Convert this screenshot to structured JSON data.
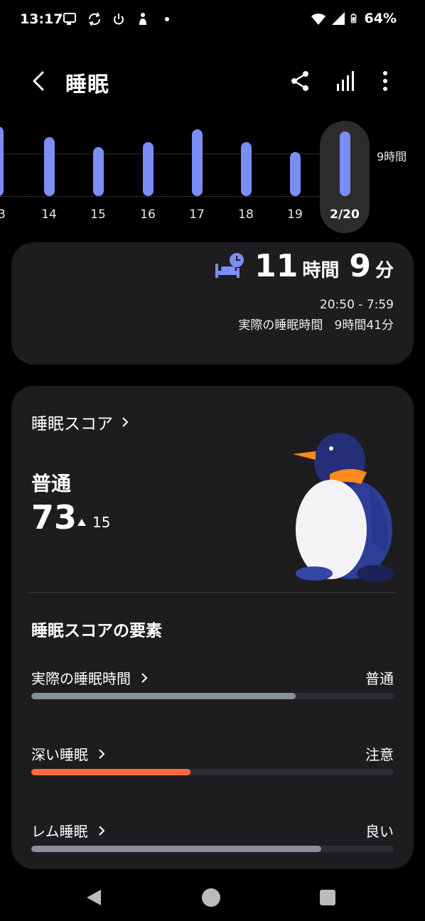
{
  "status_bar": {
    "time": "13:17",
    "battery": "64%",
    "icons": [
      "notification-icon",
      "sync-icon",
      "power-icon",
      "figure-icon",
      "dot-icon",
      "wifi-icon",
      "signal-icon",
      "battery-icon"
    ]
  },
  "header": {
    "title": "睡眠",
    "actions": [
      "share-icon",
      "stats-icon",
      "more-icon"
    ]
  },
  "chart_data": {
    "type": "bar",
    "categories": [
      "13",
      "14",
      "15",
      "16",
      "17",
      "18",
      "19",
      "2/20"
    ],
    "values": [
      9.1,
      8.3,
      7.5,
      7.9,
      8.9,
      7.9,
      7.1,
      8.7
    ],
    "selected": "2/20",
    "reference_line": "9時間",
    "bar_color": "#7b8ef5"
  },
  "duration": {
    "hours": "11",
    "hours_unit": "時間",
    "minutes": "9",
    "minutes_unit": "分",
    "range": "20:50 - 7:59",
    "actual_label": "実際の睡眠時間",
    "actual_value": "9時間41分"
  },
  "score": {
    "title": "睡眠スコア",
    "level": "普通",
    "value": "73",
    "delta": "15",
    "factors_title": "睡眠スコアの要素",
    "factors": [
      {
        "name": "実際の睡眠時間",
        "status": "普通",
        "fraction": 0.73,
        "color": "#8a9099"
      },
      {
        "name": "深い睡眠",
        "status": "注意",
        "fraction": 0.44,
        "color": "#ff6a3d"
      },
      {
        "name": "レム睡眠",
        "status": "良い",
        "fraction": 0.8,
        "color": "#8a9099"
      }
    ]
  },
  "nav": [
    "back-nav-icon",
    "home-nav-icon",
    "recents-nav-icon"
  ]
}
